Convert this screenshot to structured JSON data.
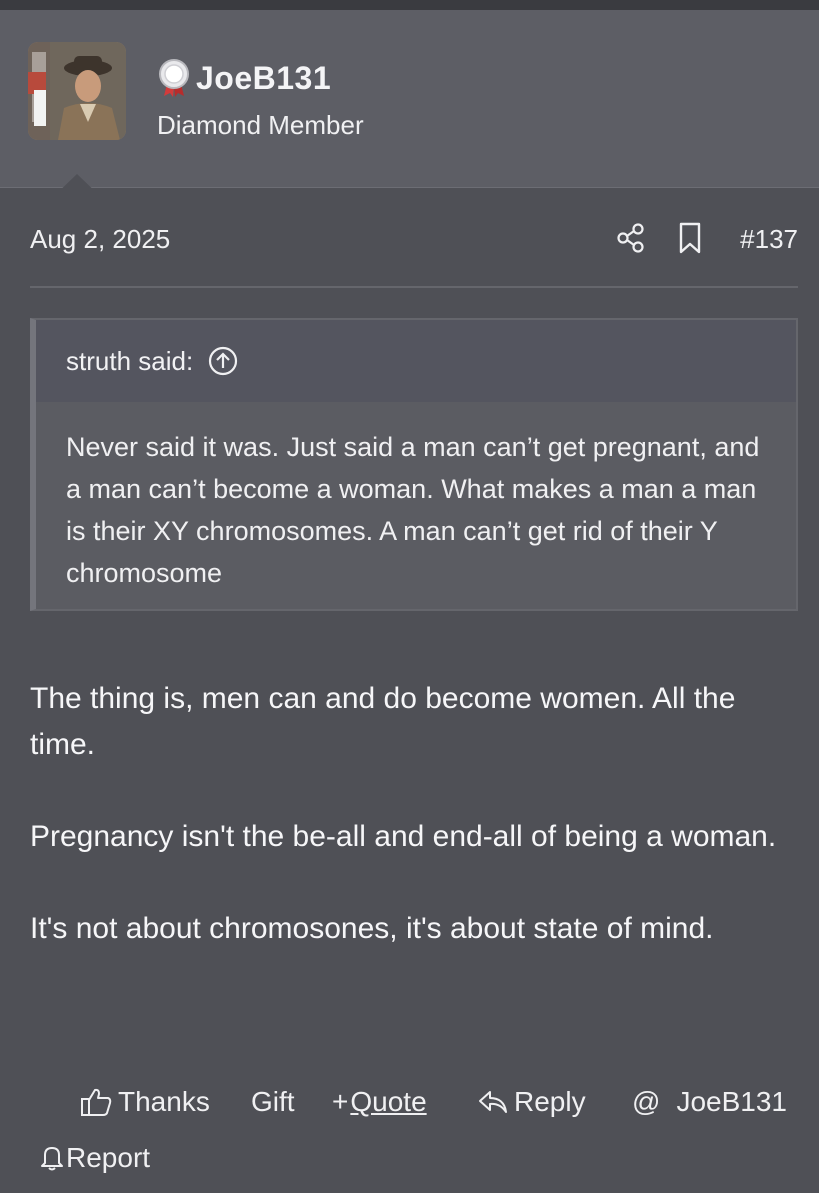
{
  "user": {
    "name": "JoeB131",
    "title": "Diamond Member"
  },
  "post": {
    "date": "Aug 2, 2025",
    "number": "#137",
    "quote": {
      "author": "struth said:",
      "text": "Never said it was. Just said a man can’t get pregnant, and a man can’t become a woman. What makes a man a man is their XY chromosomes. A man can’t get rid of their Y chromosome"
    },
    "paragraphs": [
      "The thing is, men can and do become women. All the time.",
      "Pregnancy isn't the be-all and end-all of being a woman.",
      "It's not about chromosones, it's about state of mind."
    ]
  },
  "actions": {
    "thanks": "Thanks",
    "gift": "Gift",
    "quote": "Quote",
    "quote_prefix": "+",
    "reply": "Reply",
    "mention_symbol": "@",
    "mention": "JoeB131",
    "report": "Report"
  },
  "icons": [
    "medal-icon",
    "share-icon",
    "bookmark-icon",
    "arrow-up-circle-icon",
    "thumbs-up-icon",
    "reply-icon",
    "bell-icon"
  ]
}
